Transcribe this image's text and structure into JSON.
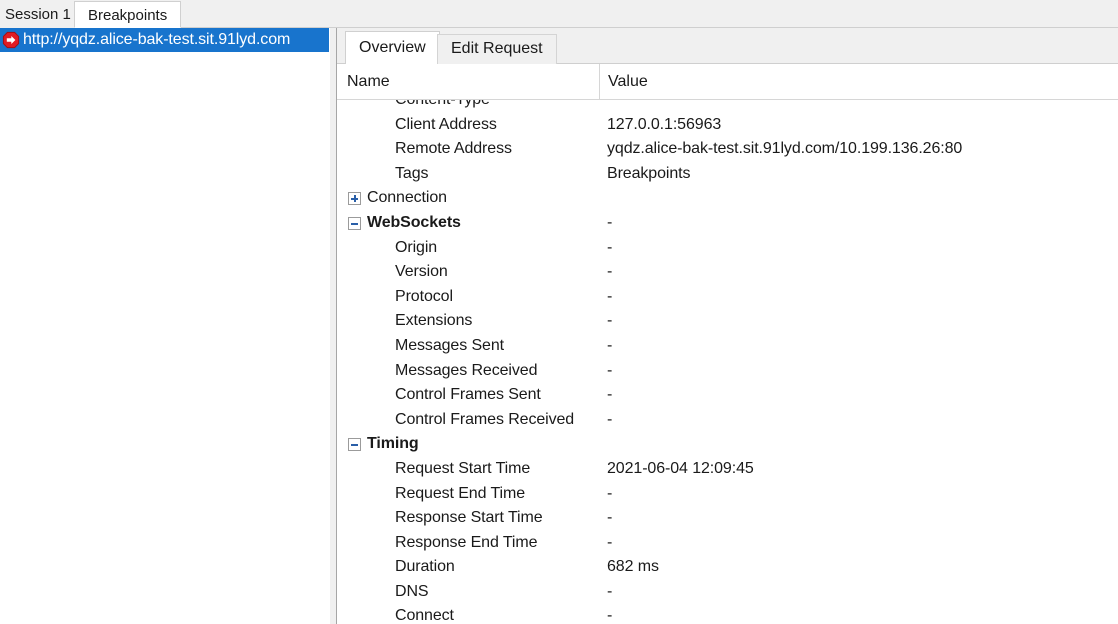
{
  "window": {
    "session_tabs": [
      {
        "label": "Session 1 *",
        "active": false
      },
      {
        "label": "Breakpoints",
        "active": true
      }
    ]
  },
  "left_panel": {
    "items": [
      {
        "icon": "breakpoint-icon",
        "label": "http://yqdz.alice-bak-test.sit.91lyd.com",
        "selected": true
      }
    ]
  },
  "detail_panel": {
    "tabs": [
      {
        "label": "Overview",
        "active": true
      },
      {
        "label": "Edit Request",
        "active": false
      }
    ],
    "grid": {
      "columns": [
        {
          "label": "Name"
        },
        {
          "label": "Value"
        }
      ],
      "rows": [
        {
          "level": "child",
          "name": "Content-Type",
          "value": "",
          "toggle": ""
        },
        {
          "level": "child",
          "name": "Client Address",
          "value": "127.0.0.1:56963",
          "toggle": ""
        },
        {
          "level": "child",
          "name": "Remote Address",
          "value": "yqdz.alice-bak-test.sit.91lyd.com/10.199.136.26:80",
          "toggle": ""
        },
        {
          "level": "child",
          "name": "Tags",
          "value": "Breakpoints",
          "toggle": ""
        },
        {
          "level": "group-plain",
          "name": "Connection",
          "value": "",
          "toggle": "plus"
        },
        {
          "level": "group",
          "name": "WebSockets",
          "value": "-",
          "toggle": "minus"
        },
        {
          "level": "child",
          "name": "Origin",
          "value": "-",
          "toggle": ""
        },
        {
          "level": "child",
          "name": "Version",
          "value": "-",
          "toggle": ""
        },
        {
          "level": "child",
          "name": "Protocol",
          "value": "-",
          "toggle": ""
        },
        {
          "level": "child",
          "name": "Extensions",
          "value": "-",
          "toggle": ""
        },
        {
          "level": "child",
          "name": "Messages Sent",
          "value": "-",
          "toggle": ""
        },
        {
          "level": "child",
          "name": "Messages Received",
          "value": "-",
          "toggle": ""
        },
        {
          "level": "child",
          "name": "Control Frames Sent",
          "value": "-",
          "toggle": ""
        },
        {
          "level": "child",
          "name": "Control Frames Received",
          "value": "-",
          "toggle": ""
        },
        {
          "level": "group",
          "name": "Timing",
          "value": "",
          "toggle": "minus"
        },
        {
          "level": "child",
          "name": "Request Start Time",
          "value": "2021-06-04 12:09:45",
          "toggle": ""
        },
        {
          "level": "child",
          "name": "Request End Time",
          "value": "-",
          "toggle": ""
        },
        {
          "level": "child",
          "name": "Response Start Time",
          "value": "-",
          "toggle": ""
        },
        {
          "level": "child",
          "name": "Response End Time",
          "value": "-",
          "toggle": ""
        },
        {
          "level": "child",
          "name": "Duration",
          "value": "682 ms",
          "toggle": ""
        },
        {
          "level": "child",
          "name": "DNS",
          "value": "-",
          "toggle": ""
        },
        {
          "level": "child",
          "name": "Connect",
          "value": "-",
          "toggle": ""
        }
      ]
    }
  },
  "colors": {
    "selection_blue": "#1874cd",
    "breakpoint_red": "#e01b24",
    "tab_bar_gray": "#f0f0f0",
    "tree_icon_blue": "#2a5fa8"
  }
}
